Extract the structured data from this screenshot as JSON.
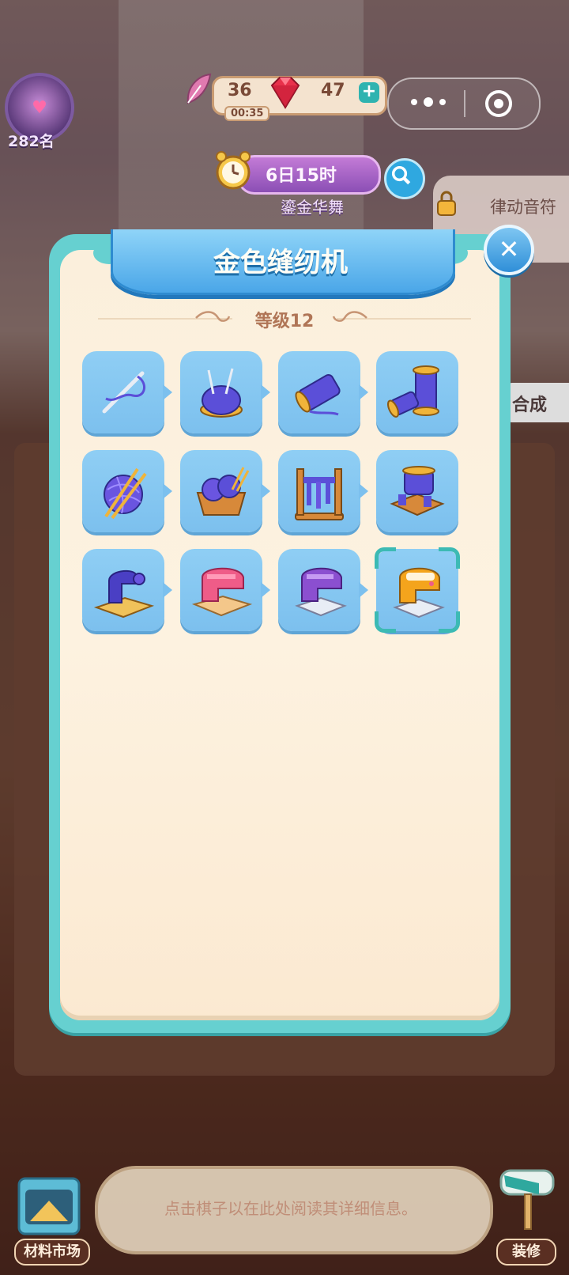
{
  "hud": {
    "rank": "282名",
    "energy": "36",
    "energy_timer": "00:35",
    "gems": "47",
    "plus": "+"
  },
  "event": {
    "timer": "6日15时",
    "name": "鎏金华舞",
    "side_label": "律动音符"
  },
  "merge_label": "合成",
  "dialog": {
    "title": "金色缝纫机",
    "level": "等级12",
    "close": "✕",
    "items": [
      {
        "icon": "needle-thread-icon"
      },
      {
        "icon": "pincushion-icon"
      },
      {
        "icon": "thread-spool-icon"
      },
      {
        "icon": "double-spool-icon"
      },
      {
        "icon": "yarn-ball-icon"
      },
      {
        "icon": "yarn-basket-icon"
      },
      {
        "icon": "thread-rack-icon"
      },
      {
        "icon": "spool-winder-icon"
      },
      {
        "icon": "vintage-sewing-machine-icon"
      },
      {
        "icon": "pink-sewing-machine-icon"
      },
      {
        "icon": "purple-sewing-machine-icon"
      },
      {
        "icon": "golden-sewing-machine-icon"
      }
    ],
    "selected_index": 11
  },
  "bottom": {
    "hint": "点击棋子以在此处阅读其详细信息。",
    "market_label": "材料市场",
    "decor_label": "装修"
  },
  "colors": {
    "dialog_border": "#66d0d0",
    "title_blue": "#4aa6e8",
    "tile_blue": "#7cc0ee",
    "selection": "#3cbab4"
  }
}
